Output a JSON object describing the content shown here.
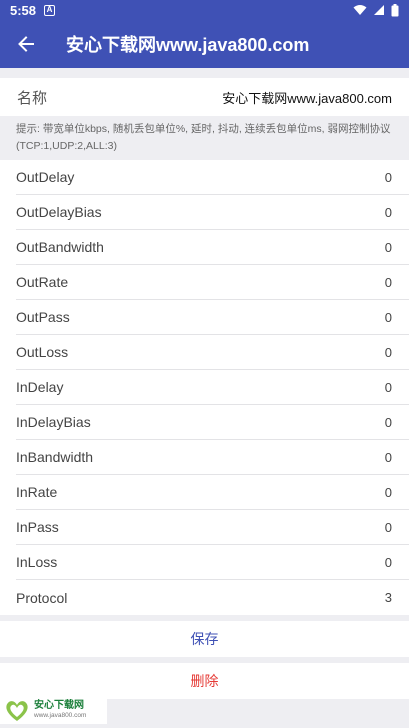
{
  "status_bar": {
    "time": "5:58",
    "notification_icon": "A"
  },
  "app_bar": {
    "title": "安心下载网www.java800.com"
  },
  "name_row": {
    "label": "名称",
    "value": "安心下载网www.java800.com"
  },
  "hint": "提示: 带宽单位kbps, 随机丢包单位%, 延时, 抖动, 连续丢包单位ms, 弱网控制协议(TCP:1,UDP:2,ALL:3)",
  "params": [
    {
      "name": "OutDelay",
      "value": "0"
    },
    {
      "name": "OutDelayBias",
      "value": "0"
    },
    {
      "name": "OutBandwidth",
      "value": "0"
    },
    {
      "name": "OutRate",
      "value": "0"
    },
    {
      "name": "OutPass",
      "value": "0"
    },
    {
      "name": "OutLoss",
      "value": "0"
    },
    {
      "name": "InDelay",
      "value": "0"
    },
    {
      "name": "InDelayBias",
      "value": "0"
    },
    {
      "name": "InBandwidth",
      "value": "0"
    },
    {
      "name": "InRate",
      "value": "0"
    },
    {
      "name": "InPass",
      "value": "0"
    },
    {
      "name": "InLoss",
      "value": "0"
    },
    {
      "name": "Protocol",
      "value": "3"
    }
  ],
  "actions": {
    "save": "保存",
    "delete": "删除"
  },
  "watermark": {
    "title": "安心下载网",
    "url": "www.java800.com"
  },
  "colors": {
    "primary": "#3f51b5",
    "danger": "#e53935",
    "background": "#eeeef2"
  }
}
